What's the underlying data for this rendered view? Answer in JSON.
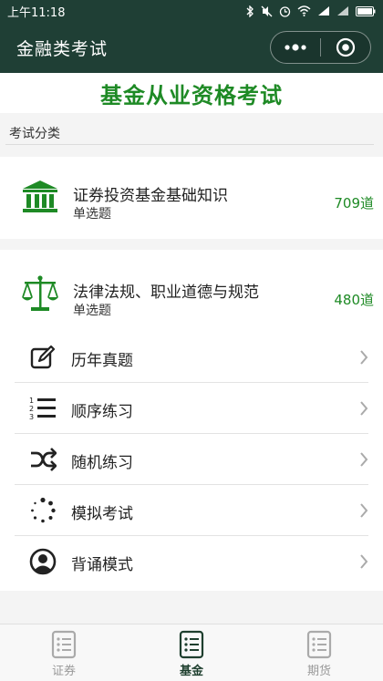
{
  "status": {
    "time": "上午11:18",
    "icons": [
      "bluetooth-icon",
      "mute-icon",
      "alarm-icon",
      "wifi-icon",
      "signal-icon",
      "battery-icon"
    ]
  },
  "nav": {
    "title": "金融类考试",
    "more_icon": "more-dots-icon",
    "close_icon": "close-circle-icon"
  },
  "banner": {
    "title": "基金从业资格考试"
  },
  "category": {
    "label": "考试分类"
  },
  "subjects": [
    {
      "name": "证券投资基金基础知识",
      "type": "单选题",
      "count": "709道",
      "icon": "bank-icon"
    },
    {
      "name": "法律法规、职业道德与规范",
      "type": "单选题",
      "count": "480道",
      "icon": "scale-icon"
    }
  ],
  "menu": [
    {
      "label": "历年真题",
      "icon": "edit-icon"
    },
    {
      "label": "顺序练习",
      "icon": "ordered-list-icon"
    },
    {
      "label": "随机练习",
      "icon": "shuffle-icon"
    },
    {
      "label": "模拟考试",
      "icon": "loading-icon"
    },
    {
      "label": "背诵模式",
      "icon": "user-circle-icon"
    }
  ],
  "tabs": [
    {
      "label": "证券",
      "icon": "list-icon",
      "active": false
    },
    {
      "label": "基金",
      "icon": "list-icon",
      "active": true
    },
    {
      "label": "期货",
      "icon": "list-icon",
      "active": false
    }
  ],
  "colors": {
    "accent": "#1e8a25",
    "navbar": "#1f3f35",
    "tab_active": "#1e3f2e"
  }
}
